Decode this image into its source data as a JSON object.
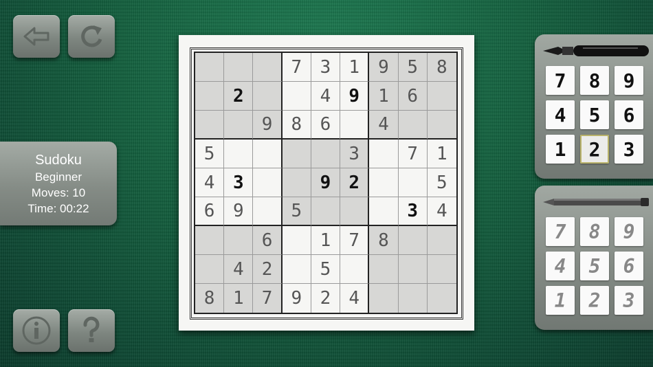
{
  "app": "Sudoku",
  "info": {
    "title": "Sudoku",
    "difficulty": "Beginner",
    "moves": "Moves: 10",
    "time": "Time: 00:22"
  },
  "buttons": {
    "back_icon": "back-arrow-icon",
    "redo_icon": "redo-icon",
    "info_icon": "info-icon",
    "help_icon": "help-question-icon"
  },
  "board": {
    "cells": [
      [
        "",
        "",
        "",
        "7",
        "3",
        "1",
        "9",
        "5",
        "8"
      ],
      [
        "",
        "2",
        "",
        "",
        "4",
        "9",
        "1",
        "6",
        ""
      ],
      [
        "",
        "",
        "9",
        "8",
        "6",
        "",
        "4",
        "",
        ""
      ],
      [
        "5",
        "",
        "",
        "",
        "",
        "3",
        "",
        "7",
        "1"
      ],
      [
        "4",
        "3",
        "",
        "",
        "9",
        "2",
        "",
        "",
        "5"
      ],
      [
        "6",
        "9",
        "",
        "5",
        "",
        "",
        "",
        "3",
        "4"
      ],
      [
        "",
        "",
        "6",
        "",
        "1",
        "7",
        "8",
        "",
        ""
      ],
      [
        "",
        "4",
        "2",
        "",
        "5",
        "",
        "",
        "",
        ""
      ],
      [
        "8",
        "1",
        "7",
        "9",
        "2",
        "4",
        "",
        "",
        ""
      ]
    ],
    "user_entries": [
      [
        false,
        false,
        false,
        false,
        false,
        false,
        false,
        false,
        false
      ],
      [
        false,
        true,
        false,
        false,
        false,
        true,
        false,
        false,
        false
      ],
      [
        false,
        false,
        false,
        false,
        false,
        false,
        false,
        false,
        false
      ],
      [
        false,
        false,
        false,
        false,
        false,
        false,
        false,
        false,
        false
      ],
      [
        false,
        true,
        false,
        false,
        true,
        true,
        false,
        false,
        false
      ],
      [
        false,
        false,
        false,
        false,
        false,
        false,
        false,
        true,
        false
      ],
      [
        false,
        false,
        false,
        false,
        false,
        false,
        false,
        false,
        false
      ],
      [
        false,
        false,
        false,
        false,
        false,
        false,
        false,
        false,
        false
      ],
      [
        false,
        false,
        false,
        false,
        false,
        false,
        false,
        false,
        false
      ]
    ]
  },
  "pen_pad": {
    "tool_icon": "fountain-pen-icon",
    "keys": [
      "7",
      "8",
      "9",
      "4",
      "5",
      "6",
      "1",
      "2",
      "3"
    ],
    "selected": "2"
  },
  "pencil_pad": {
    "tool_icon": "pencil-icon",
    "keys": [
      "7",
      "8",
      "9",
      "4",
      "5",
      "6",
      "1",
      "2",
      "3"
    ]
  }
}
